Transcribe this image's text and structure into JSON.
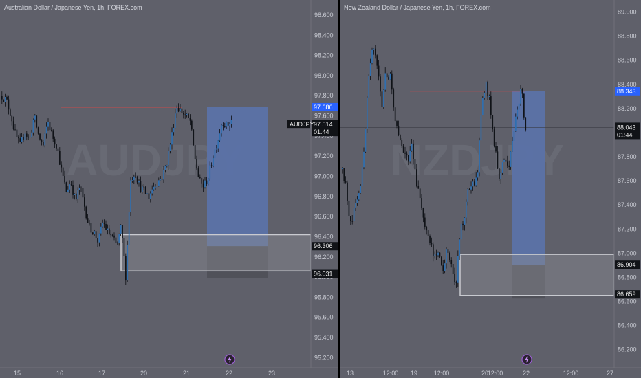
{
  "theme": {
    "background": "#5f606a",
    "bull": "#2f6fb0",
    "bear": "#101318",
    "target_zone": "#5b72a8",
    "stop_zone": "#4f5059",
    "demand_zone": "#8a8b93",
    "resistance_line": "#c84a4a",
    "last_price_badge": "#2962ff",
    "separator": "#000000"
  },
  "charts": [
    {
      "id": "left",
      "title": "Australian Dollar / Japanese Yen, 1h, FOREX.com",
      "symbol": "AUDJPY",
      "price_tag": "97.514",
      "time_tag": "01:44",
      "highlight_tag": "97.686",
      "level_tags": [
        "96.306",
        "96.031"
      ],
      "y_ticks": [
        "98.600",
        "98.400",
        "98.200",
        "98.000",
        "97.800",
        "97.600",
        "97.400",
        "97.200",
        "97.000",
        "96.800",
        "96.600",
        "96.400",
        "96.200",
        "96.000",
        "95.800",
        "95.600",
        "95.400",
        "95.200"
      ],
      "x_ticks": [
        "15",
        "16",
        "17",
        "20",
        "21",
        "22",
        "23"
      ],
      "watermark": "AUDJPY",
      "icon": "lightning-icon"
    },
    {
      "id": "right",
      "title": "New Zealand Dollar / Japanese Yen, 1h, FOREX.com",
      "price_tag": "88.043",
      "time_tag": "01:44",
      "highlight_tag": "88.343",
      "level_tags": [
        "86.904",
        "86.659"
      ],
      "y_ticks": [
        "89.000",
        "88.800",
        "88.600",
        "88.400",
        "88.200",
        "88.000",
        "87.800",
        "87.600",
        "87.400",
        "87.200",
        "87.000",
        "86.800",
        "86.600",
        "86.400",
        "86.200"
      ],
      "x_ticks": [
        "13",
        "12:00",
        "19",
        "12:00",
        "20",
        "12:00",
        "22",
        "12:00",
        "27"
      ],
      "watermark": "NZDJPY",
      "icon": "lightning-icon"
    }
  ],
  "chart_data": [
    {
      "type": "candlestick",
      "title": "Australian Dollar / Japanese Yen, 1h, FOREX.com",
      "ylim": [
        95.1,
        98.75
      ],
      "x": [
        "15",
        "16",
        "17",
        "20",
        "21",
        "22",
        "23"
      ],
      "path": [
        97.8,
        97.75,
        97.6,
        97.4,
        97.3,
        97.45,
        97.35,
        97.6,
        97.4,
        97.3,
        97.55,
        97.4,
        97.3,
        97.05,
        96.85,
        96.95,
        96.75,
        96.9,
        96.7,
        96.5,
        96.45,
        96.35,
        96.55,
        96.45,
        96.4,
        96.3,
        96.5,
        96.0,
        96.95,
        97.05,
        96.9,
        96.85,
        96.8,
        96.9,
        96.95,
        97.0,
        97.15,
        97.4,
        97.7,
        97.65,
        97.6,
        97.55,
        97.2,
        96.95,
        96.9,
        97.0,
        97.2,
        97.35,
        97.55,
        97.5,
        97.55
      ],
      "resistance": 97.686,
      "target_zone": [
        96.306,
        97.686
      ],
      "stop_zone": [
        96.031,
        96.306
      ],
      "demand_zone": [
        96.06,
        96.42
      ],
      "last_price": 97.514
    },
    {
      "type": "candlestick",
      "title": "New Zealand Dollar / Japanese Yen, 1h, FOREX.com",
      "ylim": [
        86.05,
        89.1
      ],
      "x": [
        "13",
        "12:00",
        "19",
        "12:00",
        "20",
        "12:00",
        "22",
        "12:00",
        "27"
      ],
      "path": [
        87.7,
        87.5,
        87.2,
        87.45,
        87.5,
        87.9,
        88.45,
        88.7,
        88.55,
        88.2,
        88.5,
        88.45,
        88.1,
        88.0,
        87.85,
        87.75,
        87.9,
        87.6,
        87.4,
        87.2,
        87.1,
        86.95,
        87.0,
        86.85,
        87.05,
        86.9,
        86.7,
        87.2,
        87.3,
        87.55,
        87.55,
        87.7,
        88.25,
        88.4,
        88.2,
        87.85,
        87.65,
        87.8,
        87.7,
        87.9,
        88.2,
        88.35,
        88.05
      ],
      "resistance": 88.343,
      "target_zone": [
        86.904,
        88.343
      ],
      "stop_zone": [
        86.659,
        86.904
      ],
      "demand_zone": [
        86.65,
        86.99
      ],
      "last_price": 88.043
    }
  ]
}
